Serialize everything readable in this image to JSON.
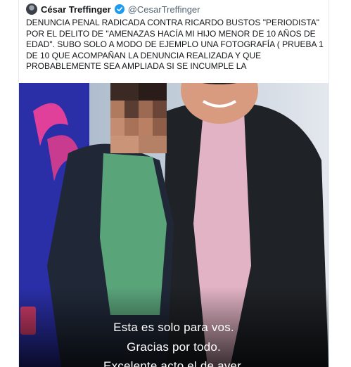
{
  "tweet": {
    "author": {
      "name": "César Treffinger",
      "handle": "@CesarTreffinger",
      "verified_icon": "verified-badge-icon"
    },
    "text_lines": [
      "DENUNCIA PENAL RADICADA CONTRA RICARDO BUSTOS \"PERIODISTA\"",
      "POR EL DELITO DE \"AMENAZAS HACÍA MI HIJO MENOR DE 10 AÑOS DE",
      "EDAD\". SUBO SOLO A MODO DE EJEMPLO UNA FOTOGRAFÍA ( PRUEBA 1",
      "DE 10 QUE ACOMPAÑAN LA DENUNCIA REALIZADA Y QUE",
      "PROBABLEMENTE SEA AMPLIADA SI SE INCUMPLE LA"
    ]
  },
  "media": {
    "caption_lines": [
      "Esta es solo para vos.",
      "Gracias por todo.",
      "Excelente acto el de ayer."
    ]
  },
  "colors": {
    "verified": "#1d9bf0",
    "text": "#14171a",
    "handle": "#536471"
  }
}
